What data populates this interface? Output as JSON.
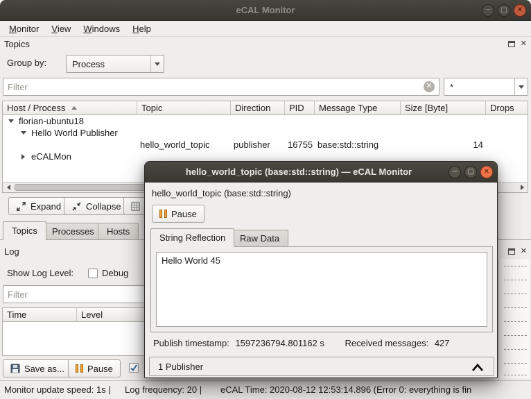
{
  "window": {
    "title": "eCAL Monitor",
    "menu": [
      "Monitor",
      "View",
      "Windows",
      "Help"
    ]
  },
  "topics": {
    "panel_title": "Topics",
    "group_by_label": "Group by:",
    "group_by_value": "Process",
    "filter_placeholder": "Filter",
    "topic_filter_value": "*",
    "columns": [
      "Host / Process",
      "Topic",
      "Direction",
      "PID",
      "Message Type",
      "Size [Byte]",
      "Drops"
    ],
    "rows": [
      {
        "label": "florian-ubuntu18"
      },
      {
        "label": "Hello World Publisher"
      },
      {
        "topic": "hello_world_topic",
        "direction": "publisher",
        "pid": "16755",
        "message_type": "base:std::string",
        "size": "14",
        "drops": ""
      },
      {
        "label": "eCALMon"
      }
    ],
    "expand_button": "Expand",
    "collapse_button": "Collapse",
    "tabs": [
      "Topics",
      "Processes",
      "Hosts"
    ]
  },
  "log": {
    "panel_title": "Log",
    "show_log_level_label": "Show Log Level:",
    "debug_label": "Debug",
    "debug_checked": false,
    "filter_placeholder": "Filter",
    "columns": [
      "Time",
      "Level"
    ],
    "save_as_button": "Save as...",
    "pause_button": "Pause",
    "extra_checkbox_checked": true
  },
  "status_bar": {
    "update_speed": "Monitor update speed: 1s |",
    "log_frequency": "Log frequency: 20 |",
    "ecal_time": "eCAL Time: 2020-08-12 12:53:14.896 (Error 0: everything is fin"
  },
  "dialog": {
    "title": "hello_world_topic (base:std::string) — eCAL Monitor",
    "heading": "hello_world_topic (base:std::string)",
    "pause_button": "Pause",
    "tabs": [
      "String Reflection",
      "Raw Data"
    ],
    "content_text": "Hello World 45",
    "publish_timestamp_label": "Publish timestamp:",
    "publish_timestamp_value": "1597236794.801162 s",
    "received_messages_label": "Received messages:",
    "received_messages_value": "427",
    "publisher_summary": "1 Publisher"
  },
  "colors": {
    "titlebar": "#3c3833",
    "close_button": "#f07248",
    "pause_icon": "#f2a43a",
    "check_accent": "#3465a4",
    "background": "#f0eeec"
  }
}
